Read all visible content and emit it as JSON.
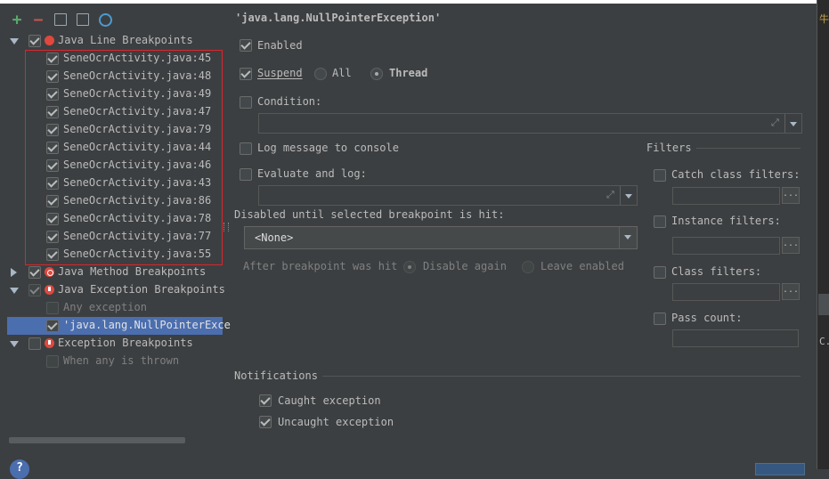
{
  "toolbar": {
    "add_icon": "plus-icon",
    "remove_icon": "minus-icon",
    "group_by_package_icon": "folder-icon",
    "group_by_file_icon": "file-icon",
    "group_by_class_icon": "class-icon"
  },
  "tree": {
    "groups": [
      {
        "label": "Java Line Breakpoints"
      },
      {
        "label": "Java Method Breakpoints"
      },
      {
        "label": "Java Exception Breakpoints"
      },
      {
        "label": "Exception Breakpoints"
      }
    ],
    "line_breakpoints": [
      "SeneOcrActivity.java:45",
      "SeneOcrActivity.java:48",
      "SeneOcrActivity.java:49",
      "SeneOcrActivity.java:47",
      "SeneOcrActivity.java:79",
      "SeneOcrActivity.java:44",
      "SeneOcrActivity.java:46",
      "SeneOcrActivity.java:43",
      "SeneOcrActivity.java:86",
      "SeneOcrActivity.java:78",
      "SeneOcrActivity.java:77",
      "SeneOcrActivity.java:55"
    ],
    "java_exception_children": [
      "Any exception",
      "'java.lang.NullPointerExce"
    ],
    "exception_children": [
      "When any is thrown"
    ]
  },
  "detail": {
    "title": "'java.lang.NullPointerException'",
    "enabled_label": "Enabled",
    "suspend_label": "Suspend",
    "suspend_all": "All",
    "suspend_thread": "Thread",
    "condition_label": "Condition:",
    "log_message_label": "Log message to console",
    "evaluate_label": "Evaluate and log:",
    "disabled_until_label": "Disabled until selected breakpoint is hit:",
    "disabled_until_value": "<None>",
    "after_hit_label": "After breakpoint was hit",
    "disable_again": "Disable again",
    "leave_enabled": "Leave enabled",
    "filters_title": "Filters",
    "catch_class_filters": "Catch class filters:",
    "instance_filters": "Instance filters:",
    "class_filters": "Class filters:",
    "pass_count": "Pass count:",
    "browse_label": "...",
    "notifications_title": "Notifications",
    "caught_exception": "Caught exception",
    "uncaught_exception": "Uncaught exception"
  },
  "help_label": "?",
  "side_chars": [
    "牛",
    "C."
  ]
}
